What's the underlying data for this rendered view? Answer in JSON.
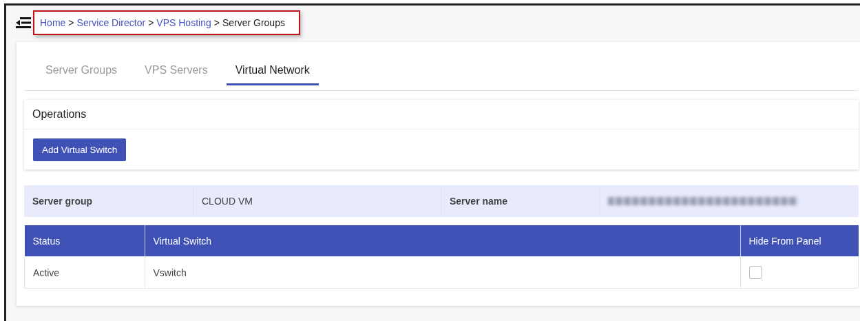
{
  "breadcrumb": [
    {
      "label": "Home",
      "link": true
    },
    {
      "label": "Service Director",
      "link": true
    },
    {
      "label": "VPS Hosting",
      "link": true
    },
    {
      "label": "Server Groups",
      "link": false
    }
  ],
  "separator": ">",
  "tabs": [
    {
      "label": "Server Groups",
      "selected": false
    },
    {
      "label": "VPS Servers",
      "selected": false
    },
    {
      "label": "Virtual Network",
      "selected": true
    }
  ],
  "operations": {
    "title": "Operations",
    "buttons": [
      "Add Virtual Switch"
    ]
  },
  "server_info": {
    "group_label": "Server group",
    "group_value": "CLOUD VM",
    "name_label": "Server name"
  },
  "table": {
    "columns": [
      "Status",
      "Virtual Switch",
      "Hide From Panel"
    ],
    "rows": [
      {
        "status": "Active",
        "virtual_switch": "Vswitch",
        "hide_from_panel": false
      }
    ]
  }
}
